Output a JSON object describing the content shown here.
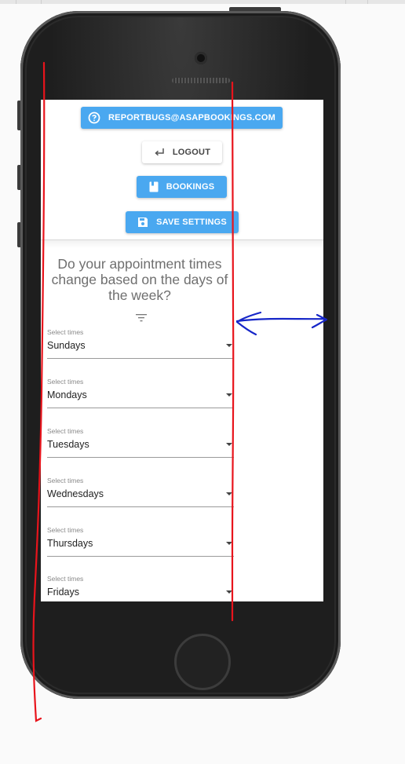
{
  "screen": {
    "buttons": {
      "report_bugs": "REPORTBUGS@ASAPBOOKINGS.COM",
      "logout": "LOGOUT",
      "bookings": "BOOKINGS",
      "save_settings": "SAVE SETTINGS"
    },
    "question": "Do your appointment times change based on the days of the week?",
    "selects": [
      {
        "label": "Select times",
        "value": "Sundays"
      },
      {
        "label": "Select times",
        "value": "Mondays"
      },
      {
        "label": "Select times",
        "value": "Tuesdays"
      },
      {
        "label": "Select times",
        "value": "Wednesdays"
      },
      {
        "label": "Select times",
        "value": "Thursdays"
      },
      {
        "label": "Select times",
        "value": "Fridays"
      }
    ]
  },
  "colors": {
    "accent": "#4aa8f0",
    "annotation_red": "#e8141c",
    "annotation_blue": "#1626c8"
  },
  "icons": [
    "help-circle-icon",
    "logout-arrow-icon",
    "book-icon",
    "save-icon",
    "filter-icon",
    "dropdown-caret-icon"
  ]
}
